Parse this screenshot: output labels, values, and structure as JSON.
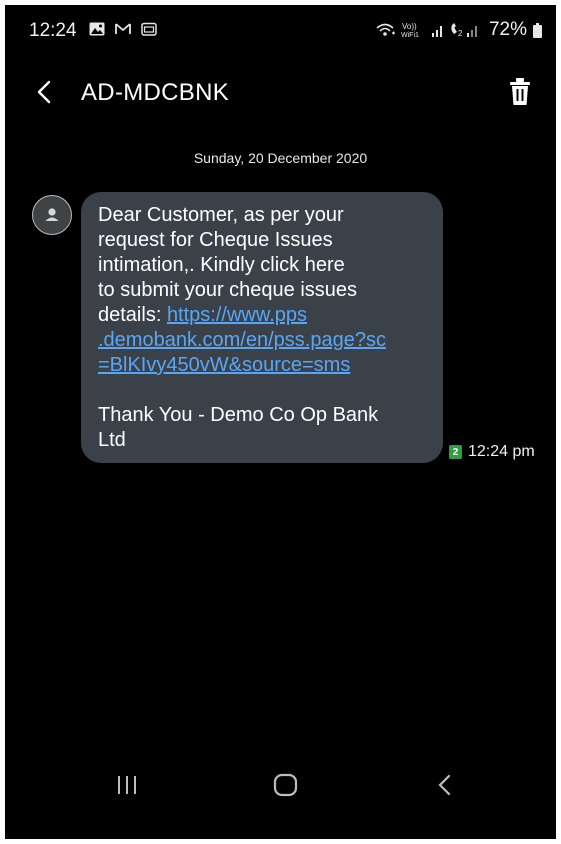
{
  "status_bar": {
    "time": "12:24",
    "notification_icons": [
      "image-icon",
      "gmail-icon",
      "media-icon"
    ],
    "signal_icons": [
      "wifi-calling-icon",
      "volte-wifi-icon",
      "sim1-signal-icon",
      "sim2-signal-icon"
    ],
    "volte_label": "Vo)) WiFi1",
    "battery": "72%"
  },
  "header": {
    "title": "AD-MDCBNK",
    "back_icon": "back-arrow-icon",
    "delete_icon": "trash-icon"
  },
  "conversation": {
    "date": "Sunday, 20 December 2020",
    "message": {
      "lines": [
        "Dear Customer, as per your",
        "request for Cheque Issues",
        "intimation,. Kindly click here",
        "to submit your cheque issues"
      ],
      "details_prefix": "details: ",
      "link_lines": [
        "https://www.pps",
        ".demobank.com/en/pss.page?sc",
        "=BlKIvy450vW&source=sms"
      ],
      "closing_lines": [
        "Thank You - Demo Co Op Bank",
        "Ltd"
      ],
      "sim": "2",
      "time": "12:24 pm"
    }
  },
  "nav_bar": {
    "icons": [
      "recent-apps-icon",
      "home-icon",
      "back-icon"
    ]
  },
  "colors": {
    "background": "#000000",
    "bubble": "#3a4149",
    "link": "#5aa6f5",
    "sim_badge": "#2f9e44"
  }
}
